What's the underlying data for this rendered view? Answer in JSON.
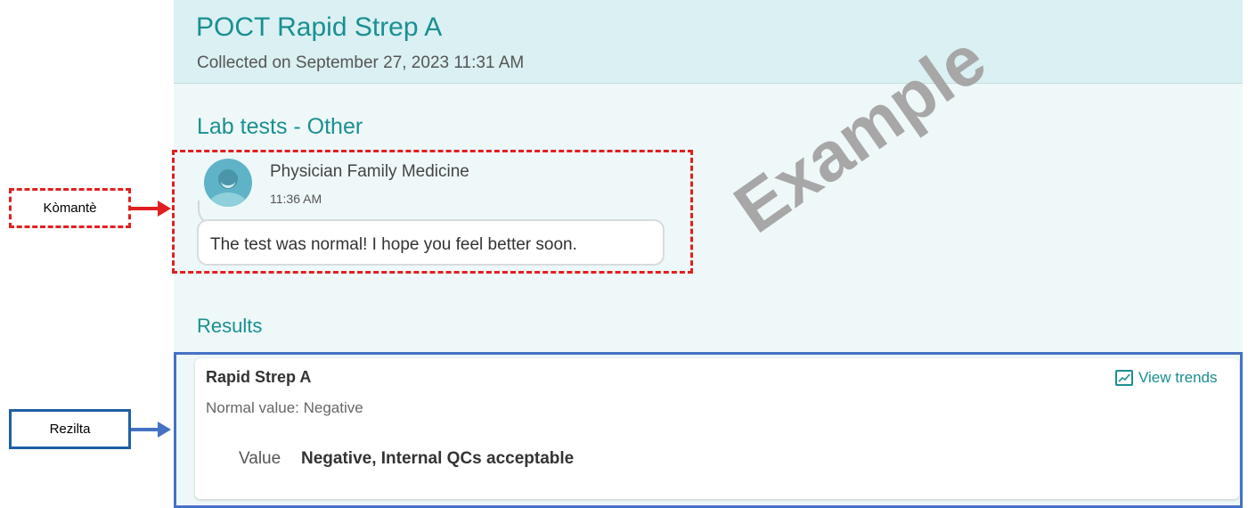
{
  "header": {
    "title": "POCT Rapid Strep A",
    "subtitle": "Collected on September 27, 2023 11:31 AM"
  },
  "comment_section": {
    "title": "Lab tests - Other",
    "author": "Physician Family Medicine",
    "time": "11:36 AM",
    "message": "The test was normal! I hope you feel better soon."
  },
  "watermark": "Example",
  "results": {
    "title": "Results",
    "test_name": "Rapid Strep A",
    "normal_value": "Normal value: Negative",
    "value_label": "Value",
    "value": "Negative, Internal QCs acceptable",
    "view_trends_label": "View trends"
  },
  "callouts": {
    "comment_label": "Kòmantè",
    "results_label": "Rezilta"
  },
  "colors": {
    "accent": "#1a8f91",
    "comment_highlight": "#e02020",
    "results_highlight": "#4472c4"
  }
}
